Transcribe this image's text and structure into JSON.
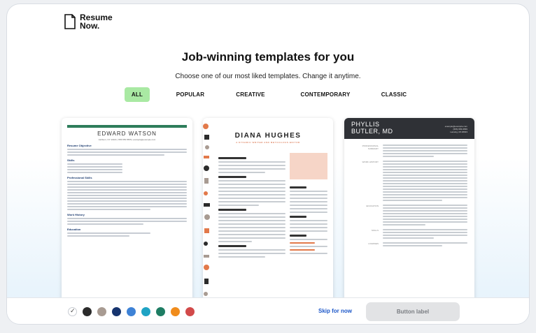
{
  "brand": {
    "line1": "Resume",
    "line2": "Now."
  },
  "page": {
    "title": "Job-winning templates for you",
    "subtitle": "Choose one of our most liked templates. Change it anytime."
  },
  "filters": [
    {
      "label": "ALL",
      "active": true
    },
    {
      "label": "POPULAR",
      "active": false
    },
    {
      "label": "CREATIVE",
      "active": false
    },
    {
      "label": "CONTEMPORARY",
      "active": false
    },
    {
      "label": "CLASSIC",
      "active": false
    }
  ],
  "templates": [
    {
      "name": "EDWARD WATSON",
      "contact": "Ashburn, NY 10101 | 555.555.5555 | example@example.com",
      "accent": "#2e7d5b",
      "sections": [
        "Resume Objective",
        "Skills",
        "Professional Skills",
        "Work History",
        "Education"
      ]
    },
    {
      "name": "DIANA HUGHES",
      "subtitle": "A DYNAMIC WRITER AND METICULOUS EDITOR",
      "accent": "#e2794a"
    },
    {
      "name_line1": "PHYLLIS",
      "name_line2": "BUTLER, MD",
      "email": "example@example.com",
      "phone": "(555) 555-5555",
      "location": "Lansing, MI 48933",
      "labels": [
        "PROFESSIONAL SUMMARY",
        "WORK HISTORY",
        "EDUCATION",
        "SKILLS",
        "LICENSES"
      ],
      "accent": "#2f3136"
    }
  ],
  "colors": [
    "#ffffff",
    "#2b2b2b",
    "#a89b92",
    "#16346e",
    "#3e82d6",
    "#1fa3c4",
    "#1e7d63",
    "#f08c1c",
    "#d24a4a"
  ],
  "footer": {
    "skip_label": "Skip for now",
    "button_label": "Button label"
  }
}
